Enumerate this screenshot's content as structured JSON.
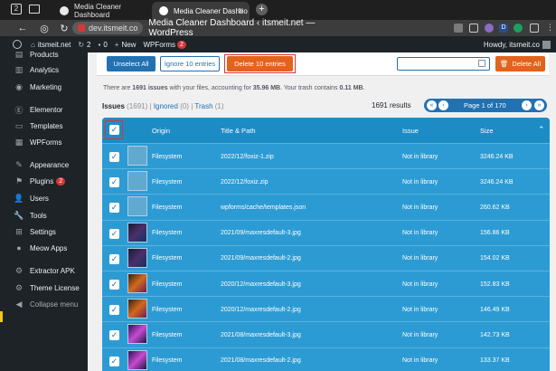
{
  "browser": {
    "tabs": [
      {
        "label": "Media Cleaner Dashboard",
        "active": false
      },
      {
        "label": "Media Cleaner Dashbo",
        "active": true
      }
    ],
    "domain": "dev.itsmeit.co",
    "page_title": "Media Cleaner Dashboard ‹ itsmeit.net — WordPress"
  },
  "adminbar": {
    "site": "itsmeit.net",
    "updates": "2",
    "comments": "0",
    "new": "New",
    "wpforms": "WPForms",
    "wpforms_badge": "2",
    "howdy": "Howdy, itsmeit.co"
  },
  "sidebar": {
    "items": [
      {
        "label": "Products",
        "icon": "products-icon"
      },
      {
        "label": "Analytics",
        "icon": "analytics-icon"
      },
      {
        "label": "Marketing",
        "icon": "marketing-icon"
      },
      {
        "label": "Elementor",
        "icon": "elementor-icon"
      },
      {
        "label": "Templates",
        "icon": "templates-icon"
      },
      {
        "label": "WPForms",
        "icon": "wpforms-icon"
      },
      {
        "label": "Appearance",
        "icon": "appearance-icon"
      },
      {
        "label": "Plugins",
        "icon": "plugins-icon",
        "badge": "2"
      },
      {
        "label": "Users",
        "icon": "users-icon"
      },
      {
        "label": "Tools",
        "icon": "tools-icon"
      },
      {
        "label": "Settings",
        "icon": "settings-icon"
      },
      {
        "label": "Meow Apps",
        "icon": "meow-apps-icon"
      },
      {
        "label": "Extractor APK",
        "icon": "extractor-icon"
      },
      {
        "label": "Theme License",
        "icon": "theme-license-icon"
      },
      {
        "label": "Collapse menu",
        "icon": "collapse-icon"
      }
    ]
  },
  "toolbar": {
    "unselect_all": "Unselect All",
    "ignore": "Ignore 10 entries",
    "delete": "Delete 10 entries",
    "delete_all": "Delete All",
    "search_value": ""
  },
  "summary": {
    "prefix": "There are ",
    "issues_count": "1691 issues",
    "mid": " with your files, accounting for ",
    "size": "35.96 MB",
    "mid2": ". Your trash contains ",
    "trash": "0.11 MB",
    "suffix": "."
  },
  "filters": {
    "issues": "Issues",
    "issues_count": "(1691)",
    "ignored": "Ignored",
    "ignored_count": "(0)",
    "trash": "Trash",
    "trash_count": "(1)",
    "results": "1691 results",
    "page": "Page 1 of 170"
  },
  "table": {
    "headers": {
      "origin": "Origin",
      "title": "Title & Path",
      "issue": "Issue",
      "size": "Size"
    },
    "rows": [
      {
        "origin": "Filesystem",
        "path": "2022/12/foxiz-1.zip",
        "issue": "Not in library",
        "size": "3246.24 KB",
        "thumb": "none"
      },
      {
        "origin": "Filesystem",
        "path": "2022/12/foxiz.zip",
        "issue": "Not in library",
        "size": "3246.24 KB",
        "thumb": "none"
      },
      {
        "origin": "Filesystem",
        "path": "wpforms/cache/templates.json",
        "issue": "Not in library",
        "size": "260.62 KB",
        "thumb": "none"
      },
      {
        "origin": "Filesystem",
        "path": "2021/09/maxresdefault-3.jpg",
        "issue": "Not in library",
        "size": "156.86 KB",
        "thumb": "dark"
      },
      {
        "origin": "Filesystem",
        "path": "2021/09/maxresdefault-2.jpg",
        "issue": "Not in library",
        "size": "154.02 KB",
        "thumb": "dark"
      },
      {
        "origin": "Filesystem",
        "path": "2020/12/maxresdefault-3.jpg",
        "issue": "Not in library",
        "size": "152.83 KB",
        "thumb": "orange"
      },
      {
        "origin": "Filesystem",
        "path": "2020/12/maxresdefault-2.jpg",
        "issue": "Not in library",
        "size": "146.49 KB",
        "thumb": "orange"
      },
      {
        "origin": "Filesystem",
        "path": "2021/08/maxresdefault-3.jpg",
        "issue": "Not in library",
        "size": "142.73 KB",
        "thumb": "purple"
      },
      {
        "origin": "Filesystem",
        "path": "2021/08/maxresdefault-2.jpg",
        "issue": "Not in library",
        "size": "133.37 KB",
        "thumb": "purple"
      }
    ]
  },
  "colors": {
    "accent": "#2271b1",
    "delete": "#e2631c",
    "table_row": "#2d9bd3",
    "sidebar": "#1d2327"
  }
}
